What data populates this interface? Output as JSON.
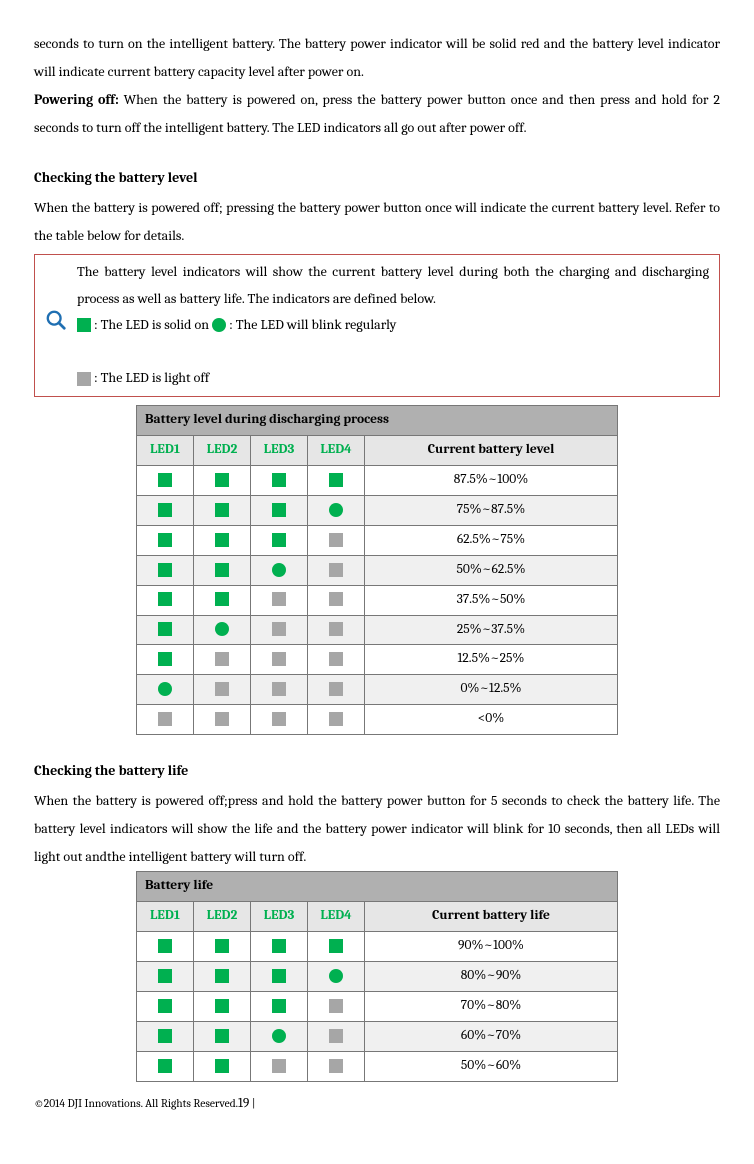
{
  "intro": {
    "p1": "seconds to turn on the intelligent battery. The battery power indicator will be solid red and the battery level indicator will indicate current battery capacity level after power on.",
    "p2_label": "Powering off:",
    "p2_body": " When the battery is powered on, press the battery power button once and then press and hold for 2 seconds to turn off the intelligent battery. The LED indicators all go out after power off."
  },
  "section1": {
    "title": "Checking the battery level",
    "body": "When the battery is powered off; pressing the battery power button once will indicate the current battery level. Refer to the table below for details.",
    "info": {
      "line1": "The battery level indicators will show the current battery level during both the charging and discharging process as well as battery life. The indicators are defined below.",
      "solid": " : The LED is solid on ",
      "blink": " : The LED will blink regularly",
      "off": " : The LED is light off"
    }
  },
  "table1": {
    "title": "Battery level during discharging process",
    "headers": {
      "led1": "LED1",
      "led2": "LED2",
      "led3": "LED3",
      "led4": "LED4",
      "lvl": "Current battery level"
    },
    "rows": [
      {
        "pattern": [
          "solid",
          "solid",
          "solid",
          "solid"
        ],
        "level": "87.5%~100%"
      },
      {
        "pattern": [
          "solid",
          "solid",
          "solid",
          "blink"
        ],
        "level": "75%~87.5%"
      },
      {
        "pattern": [
          "solid",
          "solid",
          "solid",
          "off"
        ],
        "level": "62.5%~75%"
      },
      {
        "pattern": [
          "solid",
          "solid",
          "blink",
          "off"
        ],
        "level": "50%~62.5%"
      },
      {
        "pattern": [
          "solid",
          "solid",
          "off",
          "off"
        ],
        "level": "37.5%~50%"
      },
      {
        "pattern": [
          "solid",
          "blink",
          "off",
          "off"
        ],
        "level": "25%~37.5%"
      },
      {
        "pattern": [
          "solid",
          "off",
          "off",
          "off"
        ],
        "level": "12.5%~25%"
      },
      {
        "pattern": [
          "blink",
          "off",
          "off",
          "off"
        ],
        "level": "0%~12.5%"
      },
      {
        "pattern": [
          "off",
          "off",
          "off",
          "off"
        ],
        "level": "<0%"
      }
    ]
  },
  "section2": {
    "title": "Checking the battery life",
    "body": "When the battery is powered off;press and hold the battery power button for 5 seconds to check the battery life. The battery level indicators will show the life and the battery power indicator will blink for 10 seconds, then all LEDs will light out andthe intelligent battery will turn off."
  },
  "table2": {
    "title": "Battery life",
    "headers": {
      "led1": "LED1",
      "led2": "LED2",
      "led3": "LED3",
      "led4": "LED4",
      "lvl": "Current battery life"
    },
    "rows": [
      {
        "pattern": [
          "solid",
          "solid",
          "solid",
          "solid"
        ],
        "level": "90%~100%"
      },
      {
        "pattern": [
          "solid",
          "solid",
          "solid",
          "blink"
        ],
        "level": "80%~90%"
      },
      {
        "pattern": [
          "solid",
          "solid",
          "solid",
          "off"
        ],
        "level": "70%~80%"
      },
      {
        "pattern": [
          "solid",
          "solid",
          "blink",
          "off"
        ],
        "level": "60%~70%"
      },
      {
        "pattern": [
          "solid",
          "solid",
          "off",
          "off"
        ],
        "level": "50%~60%"
      }
    ]
  },
  "footer": {
    "copyright": "©2014 DJI Innovations. All Rights Reserved.",
    "page": "19",
    "sep": " | "
  }
}
